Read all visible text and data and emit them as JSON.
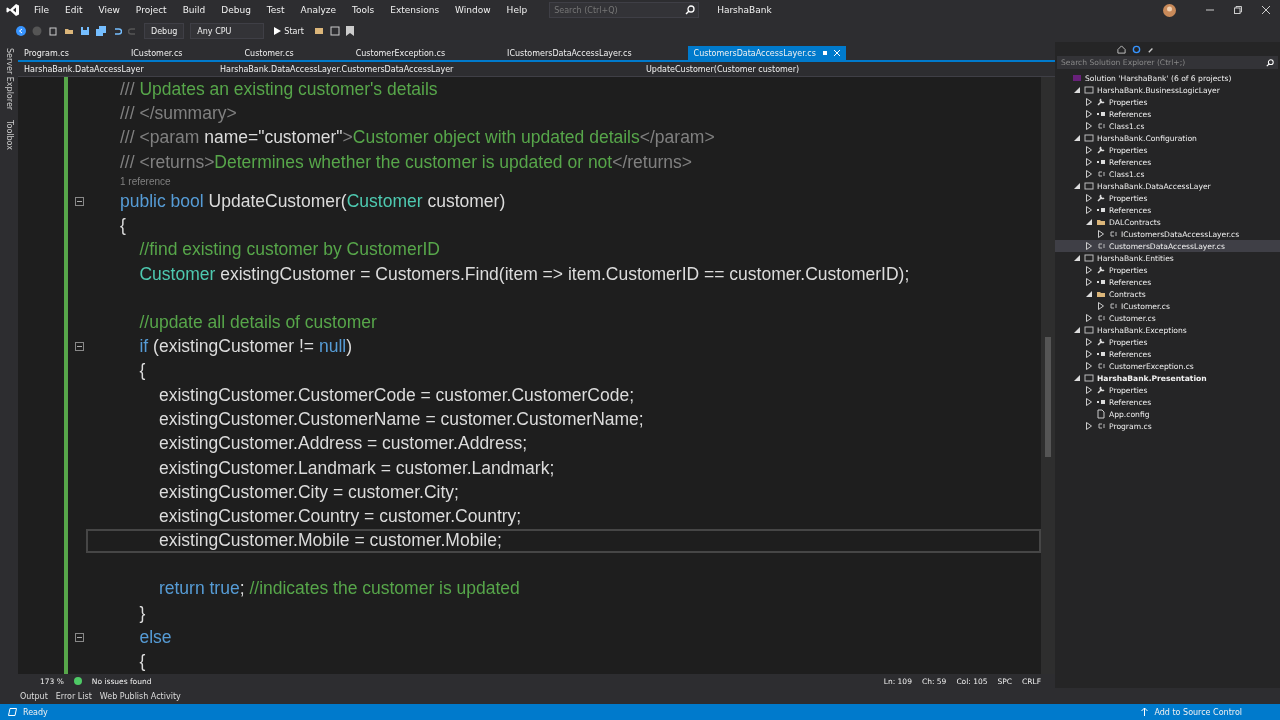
{
  "menu": [
    "File",
    "Edit",
    "View",
    "Project",
    "Build",
    "Debug",
    "Test",
    "Analyze",
    "Tools",
    "Extensions",
    "Window",
    "Help"
  ],
  "search": {
    "placeholder": "Search (Ctrl+Q)"
  },
  "window": {
    "title": "HarshaBank"
  },
  "toolbar": {
    "configuration": "Debug",
    "platform": "Any CPU",
    "start": "Start"
  },
  "tabs": [
    {
      "label": "Program.cs",
      "selected": false
    },
    {
      "label": "ICustomer.cs",
      "selected": false
    },
    {
      "label": "Customer.cs",
      "selected": false
    },
    {
      "label": "CustomerException.cs",
      "selected": false
    },
    {
      "label": "ICustomersDataAccessLayer.cs",
      "selected": false
    },
    {
      "label": "CustomersDataAccessLayer.cs",
      "selected": true
    }
  ],
  "navigation": {
    "project": "HarshaBank.DataAccessLayer",
    "type": "HarshaBank.DataAccessLayer.CustomersDataAccessLayer",
    "member": "UpdateCustomer(Customer customer)"
  },
  "side_tabs": [
    "Server Explorer",
    "Toolbox"
  ],
  "code_lines": [
    {
      "kind": "code",
      "fold": false,
      "current": false,
      "segments": [
        {
          "text": "///",
          "kind": "doc"
        },
        {
          "text": "Updates an existing customer's details",
          "kind": "docgreen"
        }
      ]
    },
    {
      "kind": "code",
      "fold": false,
      "current": false,
      "segments": [
        {
          "text": "/// </summary>",
          "kind": "doc"
        }
      ]
    },
    {
      "kind": "code",
      "fold": false,
      "current": false,
      "segments": [
        {
          "text": "/// <param",
          "kind": "doc"
        },
        {
          "text": "name=\"customer\"",
          "kind": "plain"
        },
        {
          "text": ">",
          "kind": "doc"
        },
        {
          "text": "Customer object with updated details",
          "kind": "docgreen"
        },
        {
          "text": "</param>",
          "kind": "doc"
        }
      ]
    },
    {
      "kind": "code",
      "fold": false,
      "current": false,
      "segments": [
        {
          "text": "/// <returns>",
          "kind": "doc"
        },
        {
          "text": "Determines whether the customer is updated or not",
          "kind": "docgreen"
        },
        {
          "text": "</returns>",
          "kind": "doc"
        }
      ]
    },
    {
      "kind": "lens",
      "fold": false,
      "current": false,
      "segments": [
        {
          "text": "1 reference",
          "kind": "doc"
        }
      ]
    },
    {
      "kind": "code",
      "fold": true,
      "current": false,
      "segments": [
        {
          "text": "public bool",
          "kind": "keyword"
        },
        {
          "text": "UpdateCustomer(",
          "kind": "plain"
        },
        {
          "text": "Customer",
          "kind": "type"
        },
        {
          "text": "customer)",
          "kind": "plain"
        }
      ]
    },
    {
      "kind": "code",
      "fold": false,
      "current": false,
      "segments": [
        {
          "text": "{",
          "kind": "plain"
        }
      ]
    },
    {
      "kind": "code",
      "fold": false,
      "current": false,
      "segments": [
        {
          "text": "    //find existing customer by CustomerID",
          "kind": "comment"
        }
      ]
    },
    {
      "kind": "code",
      "fold": false,
      "current": false,
      "segments": [
        {
          "text": "    Customer",
          "kind": "type"
        },
        {
          "text": "existingCustomer = Customers.Find(item => item.CustomerID == customer.CustomerID);",
          "kind": "plain"
        }
      ]
    },
    {
      "kind": "code",
      "fold": false,
      "current": false
    },
    {
      "kind": "code",
      "fold": false,
      "current": false,
      "segments": [
        {
          "text": "    //update all details of customer",
          "kind": "comment"
        }
      ]
    },
    {
      "kind": "code",
      "fold": true,
      "current": false,
      "segments": [
        {
          "text": "    if",
          "kind": "keyword"
        },
        {
          "text": "(existingCustomer !=",
          "kind": "plain"
        },
        {
          "text": "null",
          "kind": "keyword"
        },
        {
          "text": ")",
          "kind": "plain"
        }
      ]
    },
    {
      "kind": "code",
      "fold": false,
      "current": false,
      "segments": [
        {
          "text": "    {",
          "kind": "plain"
        }
      ]
    },
    {
      "kind": "code",
      "fold": false,
      "current": false,
      "segments": [
        {
          "text": "        existingCustomer.CustomerCode = customer.CustomerCode;",
          "kind": "plain"
        }
      ]
    },
    {
      "kind": "code",
      "fold": false,
      "current": false,
      "segments": [
        {
          "text": "        existingCustomer.CustomerName = customer.CustomerName;",
          "kind": "plain"
        }
      ]
    },
    {
      "kind": "code",
      "fold": false,
      "current": false,
      "segments": [
        {
          "text": "        existingCustomer.Address = customer.Address;",
          "kind": "plain"
        }
      ]
    },
    {
      "kind": "code",
      "fold": false,
      "current": false,
      "segments": [
        {
          "text": "        existingCustomer.Landmark = customer.Landmark;",
          "kind": "plain"
        }
      ]
    },
    {
      "kind": "code",
      "fold": false,
      "current": false,
      "segments": [
        {
          "text": "        existingCustomer.City = customer.City;",
          "kind": "plain"
        }
      ]
    },
    {
      "kind": "code",
      "fold": false,
      "current": false,
      "segments": [
        {
          "text": "        existingCustomer.Country = customer.Country;",
          "kind": "plain"
        }
      ]
    },
    {
      "kind": "code",
      "fold": false,
      "current": true,
      "segments": [
        {
          "text": "        existingCustomer.Mobile = customer.Mobile;",
          "kind": "plain"
        }
      ]
    },
    {
      "kind": "code",
      "fold": false,
      "current": false
    },
    {
      "kind": "code",
      "fold": false,
      "current": false,
      "segments": [
        {
          "text": "        return true",
          "kind": "keyword"
        },
        {
          "text": ";",
          "kind": "plain"
        },
        {
          "text": "//indicates the customer is updated",
          "kind": "comment"
        }
      ]
    },
    {
      "kind": "code",
      "fold": false,
      "current": false,
      "segments": [
        {
          "text": "    }",
          "kind": "plain"
        }
      ]
    },
    {
      "kind": "code",
      "fold": true,
      "current": false,
      "segments": [
        {
          "text": "    else",
          "kind": "keyword"
        }
      ]
    },
    {
      "kind": "code",
      "fold": false,
      "current": false,
      "segments": [
        {
          "text": "    {",
          "kind": "plain"
        }
      ]
    }
  ],
  "editor_status": {
    "zoom": "173 %",
    "issues": "No issues found",
    "line": "Ln: 109",
    "char": "Ch: 59",
    "column": "Col: 105",
    "whitespace": "SPC",
    "line_ending": "CRLF"
  },
  "bottom_tabs": [
    "Output",
    "Error List",
    "Web Publish Activity"
  ],
  "status_bar": {
    "state": "Ready",
    "source_control": "Add to Source Control"
  },
  "solution_explorer": {
    "search": {
      "placeholder": "Search Solution Explorer (Ctrl+;)"
    },
    "tree": [
      {
        "label": "Solution 'HarshaBank' (6 of 6 projects)",
        "kind": "solution",
        "selected": false,
        "bold": false,
        "children": [
          {
            "label": "HarshaBank.BusinessLogicLayer",
            "kind": "project",
            "expanded": true,
            "selected": false,
            "bold": false,
            "children": [
              {
                "label": "Properties",
                "kind": "properties",
                "expanded": false,
                "selected": false,
                "bold": false
              },
              {
                "label": "References",
                "kind": "references",
                "expanded": false,
                "selected": false,
                "bold": false
              },
              {
                "label": "Class1.cs",
                "kind": "cs",
                "expanded": false,
                "selected": false,
                "bold": false
              }
            ]
          },
          {
            "label": "HarshaBank.Configuration",
            "kind": "project",
            "expanded": true,
            "selected": false,
            "bold": false,
            "children": [
              {
                "label": "Properties",
                "kind": "properties",
                "expanded": false,
                "selected": false,
                "bold": false
              },
              {
                "label": "References",
                "kind": "references",
                "expanded": false,
                "selected": false,
                "bold": false
              },
              {
                "label": "Class1.cs",
                "kind": "cs",
                "expanded": false,
                "selected": false,
                "bold": false
              }
            ]
          },
          {
            "label": "HarshaBank.DataAccessLayer",
            "kind": "project",
            "expanded": true,
            "selected": false,
            "bold": false,
            "children": [
              {
                "label": "Properties",
                "kind": "properties",
                "expanded": false,
                "selected": false,
                "bold": false
              },
              {
                "label": "References",
                "kind": "references",
                "expanded": false,
                "selected": false,
                "bold": false
              },
              {
                "label": "DALContracts",
                "kind": "folder",
                "expanded": true,
                "selected": false,
                "bold": false,
                "children": [
                  {
                    "label": "ICustomersDataAccessLayer.cs",
                    "kind": "cs",
                    "expanded": false,
                    "selected": false,
                    "bold": false
                  }
                ]
              },
              {
                "label": "CustomersDataAccessLayer.cs",
                "kind": "cs",
                "expanded": false,
                "selected": true,
                "bold": false
              }
            ]
          },
          {
            "label": "HarshaBank.Entities",
            "kind": "project",
            "expanded": true,
            "selected": false,
            "bold": false,
            "children": [
              {
                "label": "Properties",
                "kind": "properties",
                "expanded": false,
                "selected": false,
                "bold": false
              },
              {
                "label": "References",
                "kind": "references",
                "expanded": false,
                "selected": false,
                "bold": false
              },
              {
                "label": "Contracts",
                "kind": "folder",
                "expanded": true,
                "selected": false,
                "bold": false,
                "children": [
                  {
                    "label": "ICustomer.cs",
                    "kind": "cs",
                    "expanded": false,
                    "selected": false,
                    "bold": false
                  }
                ]
              },
              {
                "label": "Customer.cs",
                "kind": "cs",
                "expanded": false,
                "selected": false,
                "bold": false
              }
            ]
          },
          {
            "label": "HarshaBank.Exceptions",
            "kind": "project",
            "expanded": true,
            "selected": false,
            "bold": false,
            "children": [
              {
                "label": "Properties",
                "kind": "properties",
                "expanded": false,
                "selected": false,
                "bold": false
              },
              {
                "label": "References",
                "kind": "references",
                "expanded": false,
                "selected": false,
                "bold": false
              },
              {
                "label": "CustomerException.cs",
                "kind": "cs",
                "expanded": false,
                "selected": false,
                "bold": false
              }
            ]
          },
          {
            "label": "HarshaBank.Presentation",
            "kind": "project",
            "expanded": true,
            "selected": false,
            "bold": true,
            "children": [
              {
                "label": "Properties",
                "kind": "properties",
                "expanded": false,
                "selected": false,
                "bold": false
              },
              {
                "label": "References",
                "kind": "references",
                "expanded": false,
                "selected": false,
                "bold": false
              },
              {
                "label": "App.config",
                "kind": "config",
                "selected": false,
                "bold": false
              },
              {
                "label": "Program.cs",
                "kind": "cs",
                "expanded": false,
                "selected": false,
                "bold": false
              }
            ]
          }
        ]
      }
    ]
  }
}
